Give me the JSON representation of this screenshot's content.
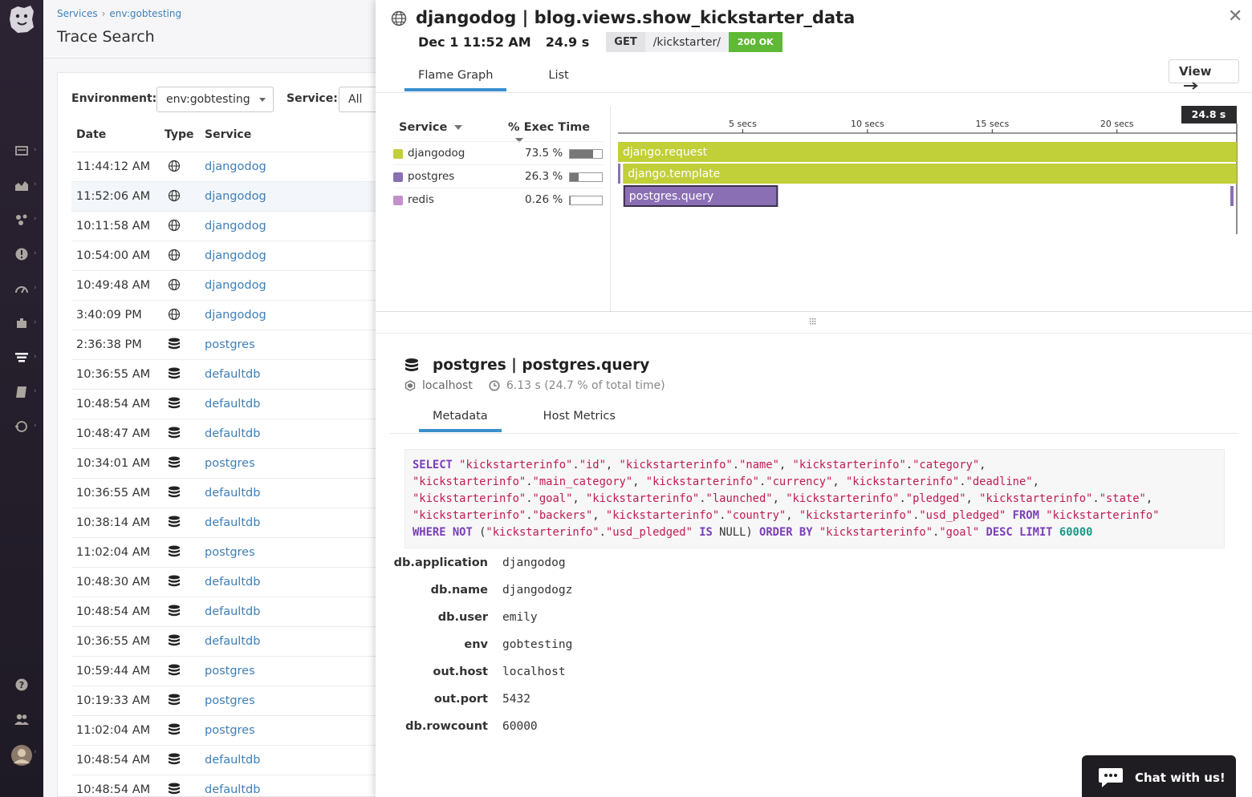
{
  "background_page": {
    "breadcrumb": {
      "services": "Services",
      "env": "env:gobtesting"
    },
    "title": "Trace Search",
    "filters": {
      "environment_label": "Environment:",
      "environment_value": "env:gobtesting",
      "service_label": "Service:",
      "service_value": "All"
    },
    "columns": {
      "date": "Date",
      "type": "Type",
      "service": "Service"
    },
    "rows": [
      {
        "date": "11:44:12 AM",
        "type": "web",
        "service": "djangodog"
      },
      {
        "date": "11:52:06 AM",
        "type": "web",
        "service": "djangodog"
      },
      {
        "date": "10:11:58 AM",
        "type": "web",
        "service": "djangodog"
      },
      {
        "date": "10:54:00 AM",
        "type": "web",
        "service": "djangodog"
      },
      {
        "date": "10:49:48 AM",
        "type": "web",
        "service": "djangodog"
      },
      {
        "date": "3:40:09 PM",
        "type": "web",
        "service": "djangodog"
      },
      {
        "date": "2:36:38 PM",
        "type": "db",
        "service": "postgres"
      },
      {
        "date": "10:36:55 AM",
        "type": "db",
        "service": "defaultdb"
      },
      {
        "date": "10:48:54 AM",
        "type": "db",
        "service": "defaultdb"
      },
      {
        "date": "10:48:47 AM",
        "type": "db",
        "service": "defaultdb"
      },
      {
        "date": "10:34:01 AM",
        "type": "db",
        "service": "postgres"
      },
      {
        "date": "10:36:55 AM",
        "type": "db",
        "service": "defaultdb"
      },
      {
        "date": "10:38:14 AM",
        "type": "db",
        "service": "defaultdb"
      },
      {
        "date": "11:02:04 AM",
        "type": "db",
        "service": "postgres"
      },
      {
        "date": "10:48:30 AM",
        "type": "db",
        "service": "defaultdb"
      },
      {
        "date": "10:48:54 AM",
        "type": "db",
        "service": "defaultdb"
      },
      {
        "date": "10:36:55 AM",
        "type": "db",
        "service": "defaultdb"
      },
      {
        "date": "10:59:44 AM",
        "type": "db",
        "service": "postgres"
      },
      {
        "date": "10:19:33 AM",
        "type": "db",
        "service": "postgres"
      },
      {
        "date": "11:02:04 AM",
        "type": "db",
        "service": "postgres"
      },
      {
        "date": "10:48:54 AM",
        "type": "db",
        "service": "defaultdb"
      },
      {
        "date": "10:48:54 AM",
        "type": "db",
        "service": "defaultdb"
      }
    ]
  },
  "trace": {
    "title": "djangodog | blog.views.show_kickstarter_data",
    "datetime": "Dec 1 11:52 AM",
    "duration": "24.9 s",
    "method": "GET",
    "path": "/kickstarter/",
    "status": "200 OK",
    "tabs": [
      "Flame Graph",
      "List"
    ],
    "view_button": "View",
    "service_header": "Service",
    "exec_header": "% Exec Time",
    "services": [
      {
        "name": "djangodog",
        "pct_label": "73.5 %",
        "pct": 73.5,
        "color": "#c1cf38"
      },
      {
        "name": "postgres",
        "pct_label": "26.3 %",
        "pct": 26.3,
        "color": "#8b6fb5"
      },
      {
        "name": "redis",
        "pct_label": "0.26 %",
        "pct": 0.26,
        "color": "#c490cc"
      }
    ],
    "timeline": {
      "total_label": "24.8 s",
      "total_seconds": 24.8,
      "ticks": [
        {
          "label": "5 secs",
          "sec": 5
        },
        {
          "label": "10 secs",
          "sec": 10
        },
        {
          "label": "15 secs",
          "sec": 15
        },
        {
          "label": "20 secs",
          "sec": 20
        }
      ]
    },
    "spans": [
      {
        "name": "django.request",
        "start": 0,
        "end": 24.8,
        "depth": 0,
        "color": "#c1cf38"
      },
      {
        "name": "django.template",
        "start": 0.2,
        "end": 24.8,
        "depth": 1,
        "color": "#c1cf38"
      },
      {
        "name": "postgres.query",
        "start": 0.25,
        "end": 6.38,
        "depth": 2,
        "color": "#8b6fb5"
      }
    ]
  },
  "span_detail": {
    "title": "postgres | postgres.query",
    "host": "localhost",
    "time": "6.13 s (24.7 %  of total time)",
    "tabs": [
      "Metadata",
      "Host Metrics"
    ],
    "sql": "SELECT \"kickstarterinfo\".\"id\", \"kickstarterinfo\".\"name\", \"kickstarterinfo\".\"category\", \"kickstarterinfo\".\"main_category\", \"kickstarterinfo\".\"currency\", \"kickstarterinfo\".\"deadline\", \"kickstarterinfo\".\"goal\", \"kickstarterinfo\".\"launched\", \"kickstarterinfo\".\"pledged\", \"kickstarterinfo\".\"state\", \"kickstarterinfo\".\"backers\", \"kickstarterinfo\".\"country\", \"kickstarterinfo\".\"usd_pledged\" FROM \"kickstarterinfo\" WHERE NOT (\"kickstarterinfo\".\"usd_pledged\" IS NULL) ORDER BY \"kickstarterinfo\".\"goal\" DESC LIMIT 60000",
    "metadata": [
      {
        "key": "db.application",
        "value": "djangodog"
      },
      {
        "key": "db.name",
        "value": "djangodogz"
      },
      {
        "key": "db.user",
        "value": "emily"
      },
      {
        "key": "env",
        "value": "gobtesting"
      },
      {
        "key": "out.host",
        "value": "localhost"
      },
      {
        "key": "out.port",
        "value": "5432"
      },
      {
        "key": "db.rowcount",
        "value": "60000"
      }
    ]
  },
  "chat": {
    "label": "Chat with us!"
  },
  "icons": {
    "nav": [
      "dashboard-icon",
      "metrics-icon",
      "integrations-icon",
      "monitors-icon",
      "apm-icon",
      "puzzle-icon",
      "traces-icon",
      "notebooks-icon",
      "logs-icon",
      "help-icon",
      "team-icon",
      "avatar"
    ]
  }
}
